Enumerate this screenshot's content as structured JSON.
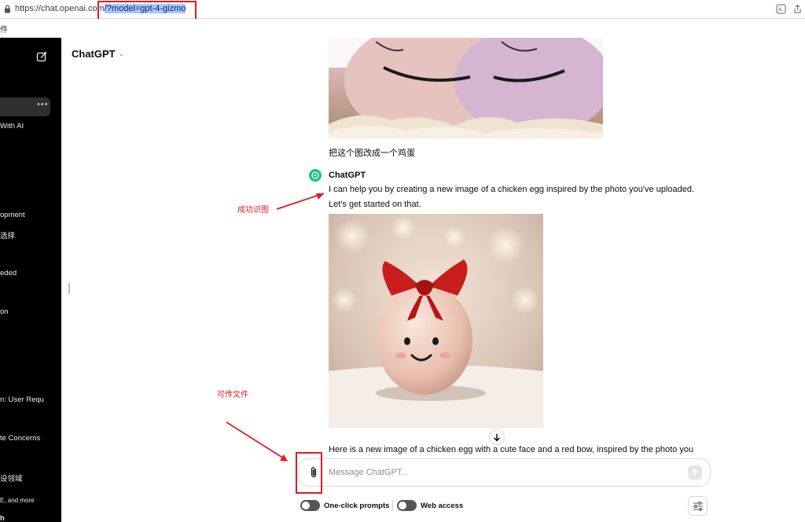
{
  "browser": {
    "url_prefix": "https://chat.openai.com",
    "url_selected": "/?model=gpt-4-gizmo",
    "bookmark_fragment": "件"
  },
  "sidebar": {
    "items": [
      {
        "label": "With AI"
      },
      {
        "label": "opment"
      },
      {
        "label": "选择"
      },
      {
        "label": "eded"
      },
      {
        "label": "on"
      },
      {
        "label": "n: User Requ"
      },
      {
        "label": "te Concerns"
      },
      {
        "label": "设领域"
      },
      {
        "label": "E, and more"
      },
      {
        "label": "h"
      }
    ]
  },
  "header": {
    "model_name": "ChatGPT"
  },
  "conversation": {
    "user_message": "把这个图改成一个鸡蛋",
    "assistant_name": "ChatGPT",
    "assistant_line1": "I can help you by creating a new image of a chicken egg inspired by the photo you've uploaded.",
    "assistant_line2": "Let's get started on that.",
    "assistant_line3": "Here is a new image of a chicken egg with a cute face and a red bow, inspired by the photo you"
  },
  "annotations": {
    "recognized": "成功识图",
    "upload": "可传文件"
  },
  "composer": {
    "placeholder": "Message ChatGPT..."
  },
  "toggles": {
    "one_click": "One-click prompts",
    "web_access": "Web access"
  },
  "colors": {
    "highlight_red": "#e01b24",
    "sidebar_bg": "#000000",
    "gpt_green": "#19c37d"
  }
}
